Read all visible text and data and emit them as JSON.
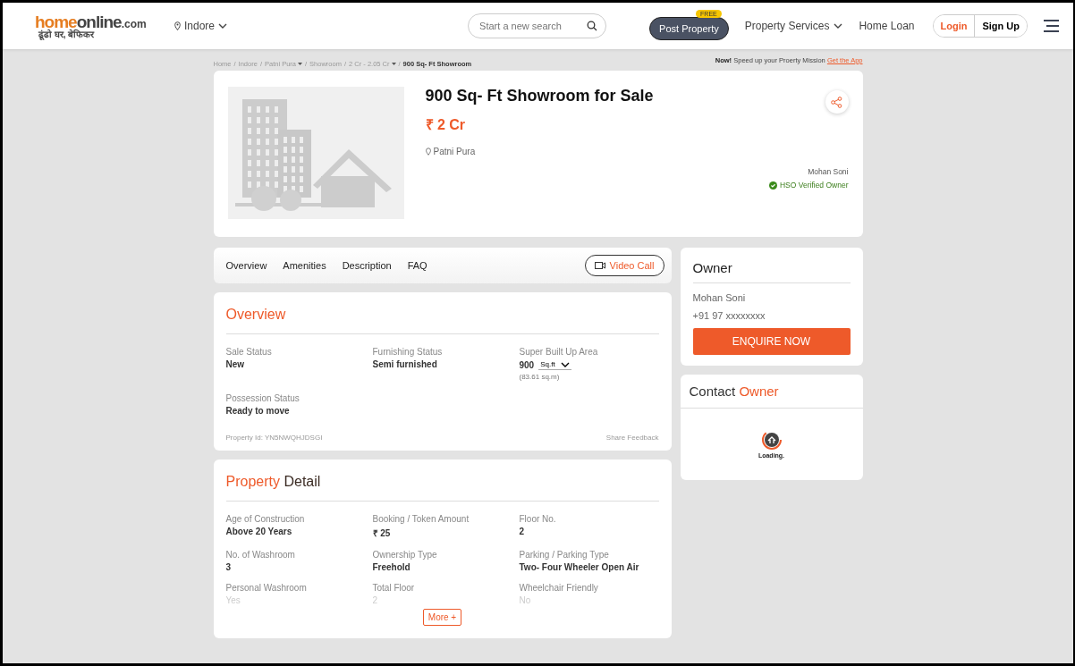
{
  "header": {
    "logo": {
      "brand": "homeonline",
      "domain": ".com",
      "tagline": "ढूंढो घर, बेफिकर"
    },
    "city": "Indore",
    "search": {
      "placeholder": "Start a new search"
    },
    "post_property": {
      "label": "Post Property",
      "badge": "FREE"
    },
    "nav": [
      "Property Services",
      "Home Loan"
    ],
    "login": "Login",
    "signup": "Sign Up"
  },
  "breadcrumb": {
    "separator": "/",
    "items": [
      {
        "label": "Home",
        "dropdown": false
      },
      {
        "label": "Indore",
        "dropdown": false
      },
      {
        "label": "Patni Pura",
        "dropdown": true
      },
      {
        "label": "Showroom",
        "dropdown": false
      },
      {
        "label": "2 Cr - 2.05 Cr",
        "dropdown": true
      },
      {
        "label": "900 Sq- Ft Showroom",
        "dropdown": false
      }
    ]
  },
  "app_promo": {
    "lead": "Now!",
    "text": "Speed up your Proerty Mission",
    "link": "Get the App"
  },
  "listing": {
    "title": "900 Sq- Ft Showroom for Sale",
    "price": "₹ 2 Cr",
    "locality": "Patni Pura",
    "owner_name": "Mohan Soni",
    "verified": "HSO Verified Owner"
  },
  "tabs": [
    {
      "label": "Overview"
    },
    {
      "label": "Amenities"
    },
    {
      "label": "Description"
    },
    {
      "label": "FAQ"
    }
  ],
  "video_call": "Video Call",
  "overview": {
    "heading": "Overview",
    "fields": [
      {
        "label": "Sale Status",
        "value": "New"
      },
      {
        "label": "Furnishing Status",
        "value": "Semi furnished"
      },
      {
        "label": "Super Built Up Area",
        "value": "900",
        "unit": "Sq.ft",
        "sub": "(83.61 sq.m)"
      },
      {
        "label": "Possession Status",
        "value": "Ready to move"
      }
    ],
    "property_id": "Property Id: YN5NWQHJDSGI",
    "feedback": "Share Feedback"
  },
  "property_detail": {
    "heading_accent": "Property",
    "heading_rest": "Detail",
    "fields": [
      {
        "label": "Age of Construction",
        "value": "Above 20 Years",
        "faded": false
      },
      {
        "label": "Booking / Token Amount",
        "value": "₹ 25",
        "faded": false
      },
      {
        "label": "Floor No.",
        "value": "2",
        "faded": false
      },
      {
        "label": "No. of Washroom",
        "value": "3",
        "faded": false
      },
      {
        "label": "Ownership Type",
        "value": "Freehold",
        "faded": false
      },
      {
        "label": "Parking / Parking Type",
        "value": "Two- Four Wheeler Open Air",
        "faded": false
      },
      {
        "label": "Personal Washroom",
        "value": "Yes",
        "faded": true
      },
      {
        "label": "Total Floor",
        "value": "2",
        "faded": true
      },
      {
        "label": "Wheelchair Friendly",
        "value": "No",
        "faded": true
      }
    ],
    "more": "More +"
  },
  "owner_card": {
    "heading": "Owner",
    "name": "Mohan Soni",
    "phone": "+91 97 xxxxxxxx",
    "button": "ENQUIRE NOW"
  },
  "contact_card": {
    "heading_rest": "Contact",
    "heading_accent": "Owner",
    "loading": "Loading."
  }
}
